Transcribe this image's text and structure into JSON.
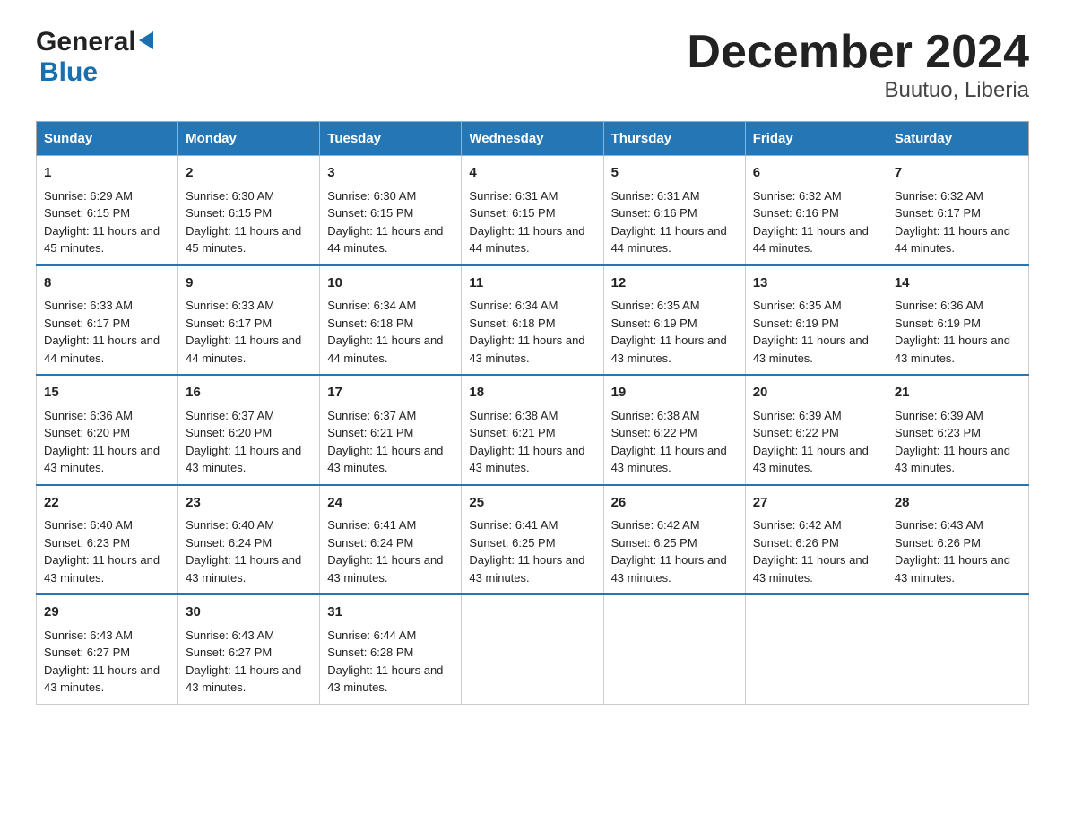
{
  "header": {
    "title": "December 2024",
    "subtitle": "Buutuo, Liberia",
    "logo_general": "General",
    "logo_blue": "Blue"
  },
  "calendar": {
    "days_of_week": [
      "Sunday",
      "Monday",
      "Tuesday",
      "Wednesday",
      "Thursday",
      "Friday",
      "Saturday"
    ],
    "weeks": [
      [
        {
          "day": "1",
          "sunrise": "6:29 AM",
          "sunset": "6:15 PM",
          "daylight": "11 hours and 45 minutes."
        },
        {
          "day": "2",
          "sunrise": "6:30 AM",
          "sunset": "6:15 PM",
          "daylight": "11 hours and 45 minutes."
        },
        {
          "day": "3",
          "sunrise": "6:30 AM",
          "sunset": "6:15 PM",
          "daylight": "11 hours and 44 minutes."
        },
        {
          "day": "4",
          "sunrise": "6:31 AM",
          "sunset": "6:15 PM",
          "daylight": "11 hours and 44 minutes."
        },
        {
          "day": "5",
          "sunrise": "6:31 AM",
          "sunset": "6:16 PM",
          "daylight": "11 hours and 44 minutes."
        },
        {
          "day": "6",
          "sunrise": "6:32 AM",
          "sunset": "6:16 PM",
          "daylight": "11 hours and 44 minutes."
        },
        {
          "day": "7",
          "sunrise": "6:32 AM",
          "sunset": "6:17 PM",
          "daylight": "11 hours and 44 minutes."
        }
      ],
      [
        {
          "day": "8",
          "sunrise": "6:33 AM",
          "sunset": "6:17 PM",
          "daylight": "11 hours and 44 minutes."
        },
        {
          "day": "9",
          "sunrise": "6:33 AM",
          "sunset": "6:17 PM",
          "daylight": "11 hours and 44 minutes."
        },
        {
          "day": "10",
          "sunrise": "6:34 AM",
          "sunset": "6:18 PM",
          "daylight": "11 hours and 44 minutes."
        },
        {
          "day": "11",
          "sunrise": "6:34 AM",
          "sunset": "6:18 PM",
          "daylight": "11 hours and 43 minutes."
        },
        {
          "day": "12",
          "sunrise": "6:35 AM",
          "sunset": "6:19 PM",
          "daylight": "11 hours and 43 minutes."
        },
        {
          "day": "13",
          "sunrise": "6:35 AM",
          "sunset": "6:19 PM",
          "daylight": "11 hours and 43 minutes."
        },
        {
          "day": "14",
          "sunrise": "6:36 AM",
          "sunset": "6:19 PM",
          "daylight": "11 hours and 43 minutes."
        }
      ],
      [
        {
          "day": "15",
          "sunrise": "6:36 AM",
          "sunset": "6:20 PM",
          "daylight": "11 hours and 43 minutes."
        },
        {
          "day": "16",
          "sunrise": "6:37 AM",
          "sunset": "6:20 PM",
          "daylight": "11 hours and 43 minutes."
        },
        {
          "day": "17",
          "sunrise": "6:37 AM",
          "sunset": "6:21 PM",
          "daylight": "11 hours and 43 minutes."
        },
        {
          "day": "18",
          "sunrise": "6:38 AM",
          "sunset": "6:21 PM",
          "daylight": "11 hours and 43 minutes."
        },
        {
          "day": "19",
          "sunrise": "6:38 AM",
          "sunset": "6:22 PM",
          "daylight": "11 hours and 43 minutes."
        },
        {
          "day": "20",
          "sunrise": "6:39 AM",
          "sunset": "6:22 PM",
          "daylight": "11 hours and 43 minutes."
        },
        {
          "day": "21",
          "sunrise": "6:39 AM",
          "sunset": "6:23 PM",
          "daylight": "11 hours and 43 minutes."
        }
      ],
      [
        {
          "day": "22",
          "sunrise": "6:40 AM",
          "sunset": "6:23 PM",
          "daylight": "11 hours and 43 minutes."
        },
        {
          "day": "23",
          "sunrise": "6:40 AM",
          "sunset": "6:24 PM",
          "daylight": "11 hours and 43 minutes."
        },
        {
          "day": "24",
          "sunrise": "6:41 AM",
          "sunset": "6:24 PM",
          "daylight": "11 hours and 43 minutes."
        },
        {
          "day": "25",
          "sunrise": "6:41 AM",
          "sunset": "6:25 PM",
          "daylight": "11 hours and 43 minutes."
        },
        {
          "day": "26",
          "sunrise": "6:42 AM",
          "sunset": "6:25 PM",
          "daylight": "11 hours and 43 minutes."
        },
        {
          "day": "27",
          "sunrise": "6:42 AM",
          "sunset": "6:26 PM",
          "daylight": "11 hours and 43 minutes."
        },
        {
          "day": "28",
          "sunrise": "6:43 AM",
          "sunset": "6:26 PM",
          "daylight": "11 hours and 43 minutes."
        }
      ],
      [
        {
          "day": "29",
          "sunrise": "6:43 AM",
          "sunset": "6:27 PM",
          "daylight": "11 hours and 43 minutes."
        },
        {
          "day": "30",
          "sunrise": "6:43 AM",
          "sunset": "6:27 PM",
          "daylight": "11 hours and 43 minutes."
        },
        {
          "day": "31",
          "sunrise": "6:44 AM",
          "sunset": "6:28 PM",
          "daylight": "11 hours and 43 minutes."
        },
        null,
        null,
        null,
        null
      ]
    ]
  }
}
